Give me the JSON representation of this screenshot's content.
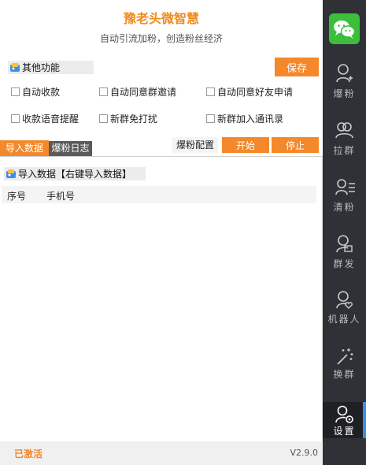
{
  "header": {
    "title": "豫老头微智慧",
    "subtitle": "自动引流加粉，创造粉丝经济"
  },
  "other_functions": {
    "label": "其他功能",
    "save_label": "保存",
    "options": [
      {
        "label": "自动收款",
        "checked": false
      },
      {
        "label": "自动同意群邀请",
        "checked": false
      },
      {
        "label": "自动同意好友申请",
        "checked": false
      },
      {
        "label": "收款语音提醒",
        "checked": false
      },
      {
        "label": "新群免打扰",
        "checked": false
      },
      {
        "label": "新群加入通讯录",
        "checked": false
      }
    ]
  },
  "tabs": [
    {
      "label": "导入数据",
      "active": true
    },
    {
      "label": "爆粉日志",
      "active": false
    }
  ],
  "actions": {
    "config_label": "爆粉配置",
    "start_label": "开始",
    "stop_label": "停止"
  },
  "import_panel": {
    "label": "导入数据【右键导入数据】",
    "columns": [
      "序号",
      "手机号"
    ],
    "rows": []
  },
  "footer": {
    "status": "已激活",
    "version": "V2.9.0"
  },
  "sidebar": {
    "logo_icon": "wechat-logo-icon",
    "items": [
      {
        "label": "爆粉",
        "icon": "user-add-icon",
        "active": false
      },
      {
        "label": "拉群",
        "icon": "group-icon",
        "active": false
      },
      {
        "label": "清粉",
        "icon": "user-list-icon",
        "active": false
      },
      {
        "label": "群发",
        "icon": "user-message-icon",
        "active": false
      },
      {
        "label": "机器人",
        "icon": "user-heart-icon",
        "active": false
      },
      {
        "label": "换群",
        "icon": "magic-wand-icon",
        "active": false
      },
      {
        "label": "设置",
        "icon": "user-settings-icon",
        "active": true
      }
    ]
  },
  "colors": {
    "accent": "#f5882a",
    "title": "#f08a1c",
    "sidebar_bg": "#2f3136",
    "sidebar_active_bg": "#1f2024",
    "active_indicator": "#3a8ee6",
    "wechat_green": "#3bbf3b"
  }
}
